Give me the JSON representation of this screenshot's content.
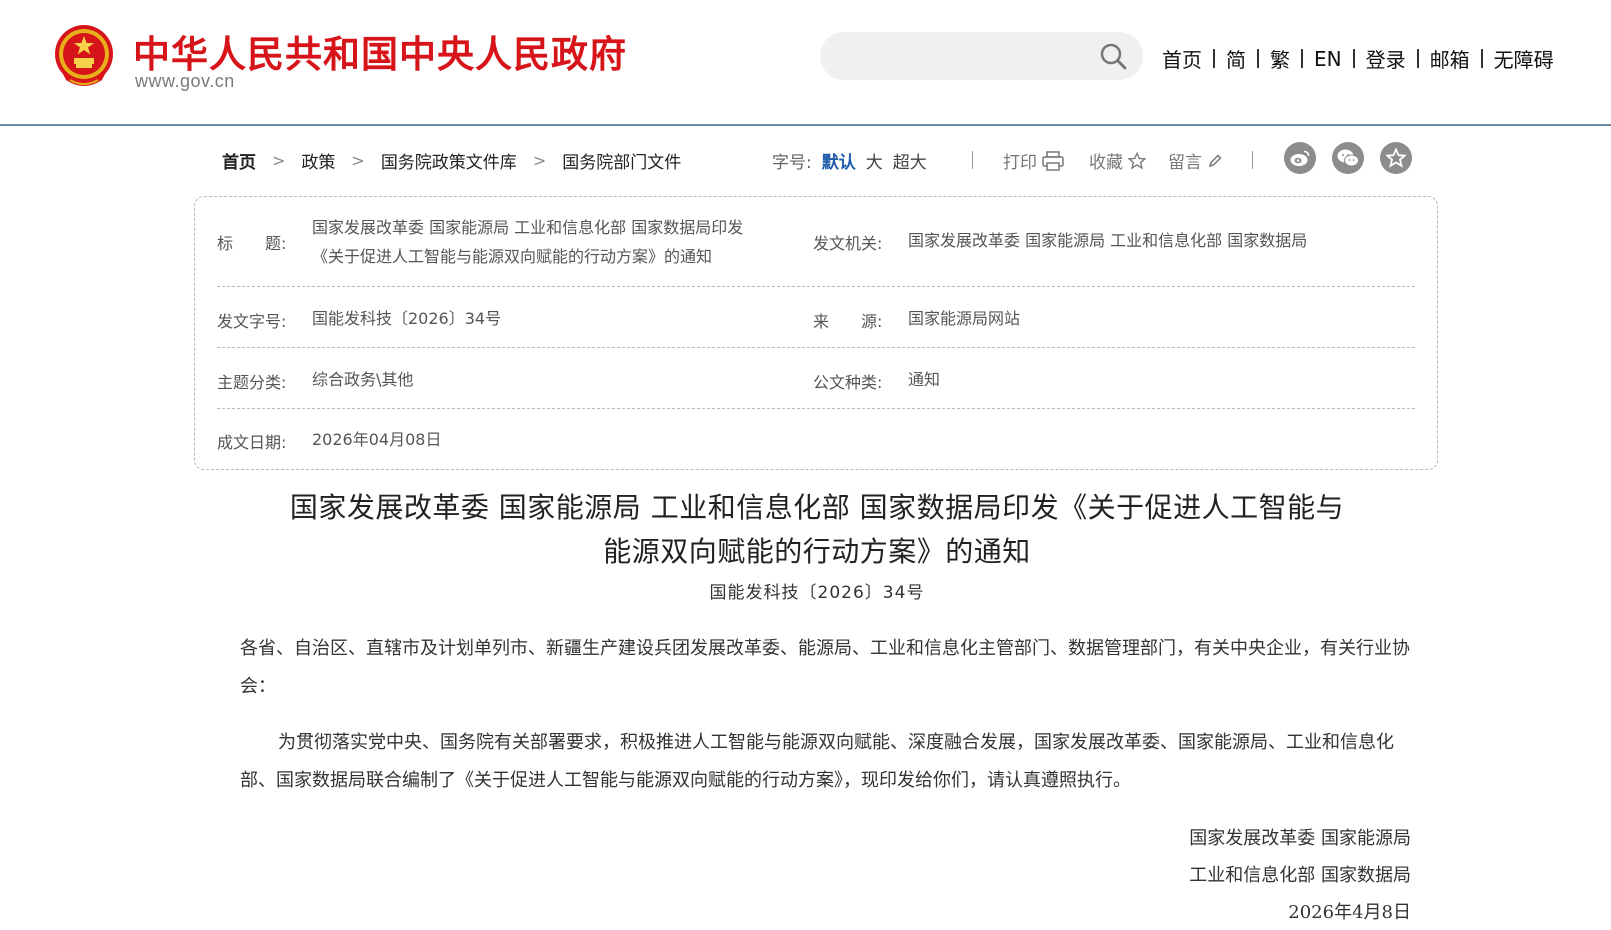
{
  "header": {
    "site_title": "中华人民共和国中央人民政府",
    "site_url": "www.gov.cn",
    "search_placeholder": "",
    "nav": [
      "首页",
      "简",
      "繁",
      "EN",
      "登录",
      "邮箱",
      "无障碍"
    ]
  },
  "breadcrumb": [
    "首页",
    "政策",
    "国务院政策文件库",
    "国务院部门文件"
  ],
  "toolbar": {
    "font_size_label": "字号:",
    "font_sizes": [
      "默认",
      "大",
      "超大"
    ],
    "print_label": "打印",
    "favorite_label": "收藏",
    "comment_label": "留言",
    "share_icons": [
      "weibo-icon",
      "wechat-icon",
      "star-icon"
    ]
  },
  "info": {
    "title_label": "标　　题:",
    "title_value_line1": "国家发展改革委 国家能源局 工业和信息化部 国家数据局印发",
    "title_value_line2": "《关于促进人工智能与能源双向赋能的行动方案》的通知",
    "issuer_label": "发文机关:",
    "issuer_value": "国家发展改革委 国家能源局 工业和信息化部 国家数据局",
    "docno_label": "发文字号:",
    "docno_value": "国能发科技〔2026〕34号",
    "source_label": "来　　源:",
    "source_value": "国家能源局网站",
    "topic_label": "主题分类:",
    "topic_value": "综合政务\\其他",
    "doctype_label": "公文种类:",
    "doctype_value": "通知",
    "date_label": "成文日期:",
    "date_value": "2026年04月08日"
  },
  "article": {
    "title_line1": "国家发展改革委 国家能源局 工业和信息化部 国家数据局印发《关于促进人工智能与",
    "title_line2": "能源双向赋能的行动方案》的通知",
    "doc_number": "国能发科技〔2026〕34号",
    "recipients": "各省、自治区、直辖市及计划单列市、新疆生产建设兵团发展改革委、能源局、工业和信息化主管部门、数据管理部门，有关中央企业，有关行业协会：",
    "body": "为贯彻落实党中央、国务院有关部署要求，积极推进人工智能与能源双向赋能、深度融合发展，国家发展改革委、国家能源局、工业和信息化部、国家数据局联合编制了《关于促进人工智能与能源双向赋能的行动方案》，现印发给你们，请认真遵照执行。",
    "signature_line1": "国家发展改革委 国家能源局",
    "signature_line2": "工业和信息化部 国家数据局",
    "signature_date": "2026年4月8日"
  },
  "colors": {
    "brand_red": "#d7141a",
    "link_blue": "#1e5aa8",
    "header_rule": "#6f8ba3"
  }
}
